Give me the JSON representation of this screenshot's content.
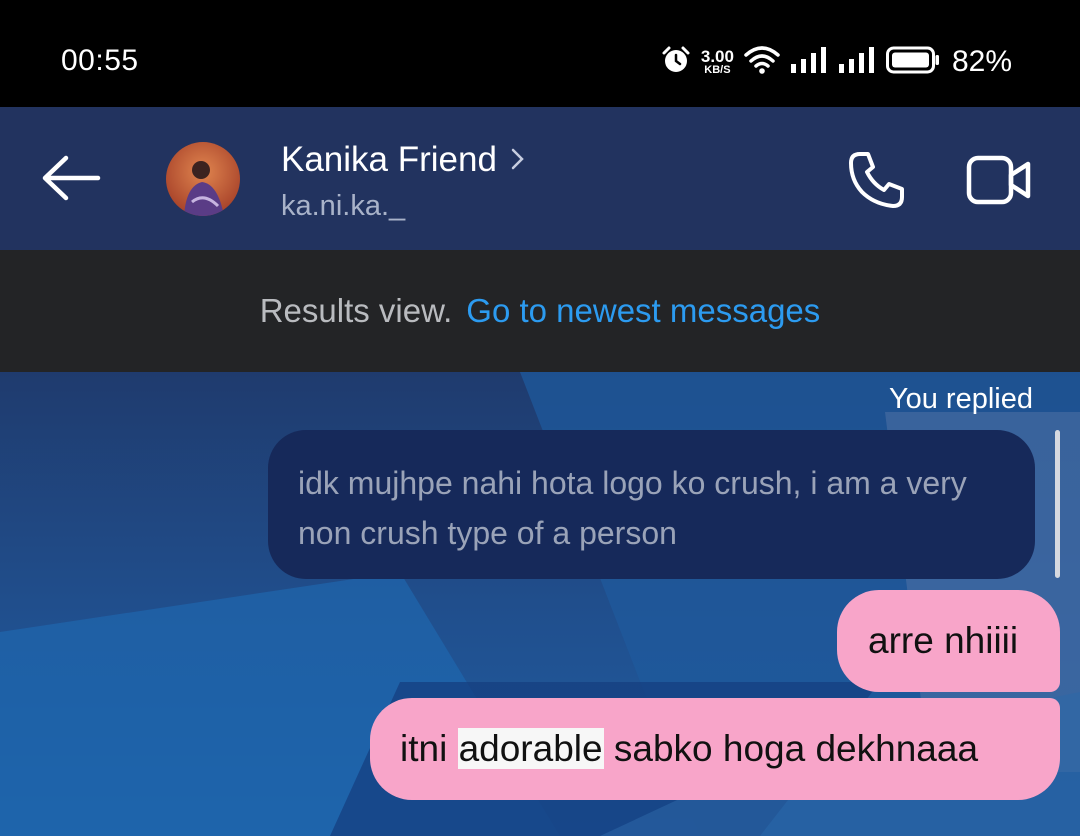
{
  "status_bar": {
    "time": "00:55",
    "net_speed_value": "3.00",
    "net_speed_unit": "KB/S",
    "battery_percent": "82%",
    "icons": [
      "alarm-icon",
      "wifi-icon",
      "signal-icon",
      "signal-icon",
      "battery-icon"
    ]
  },
  "header": {
    "contact_name": "Kanika Friend",
    "handle": "ka.ni.ka._",
    "icons": [
      "back-arrow-icon",
      "chevron-right-icon",
      "phone-icon",
      "video-icon"
    ]
  },
  "results_bar": {
    "text": "Results view.",
    "link": "Go to newest messages"
  },
  "messages": {
    "replied_label": "You replied",
    "reply_text": "idk mujhpe nahi hota logo ko crush, i am a very non crush type of a person",
    "sent": [
      {
        "text": "arre nhiiii"
      },
      {
        "before": "itni ",
        "highlighted": "adorable",
        "after": " sabko hoga dekhnaaa"
      }
    ]
  },
  "colors": {
    "header_bg": "#22335f",
    "results_bar_bg": "#232426",
    "link": "#2c9bf0",
    "sent_bubble": "#f8a5c9",
    "reply_bubble": "#16295a"
  }
}
